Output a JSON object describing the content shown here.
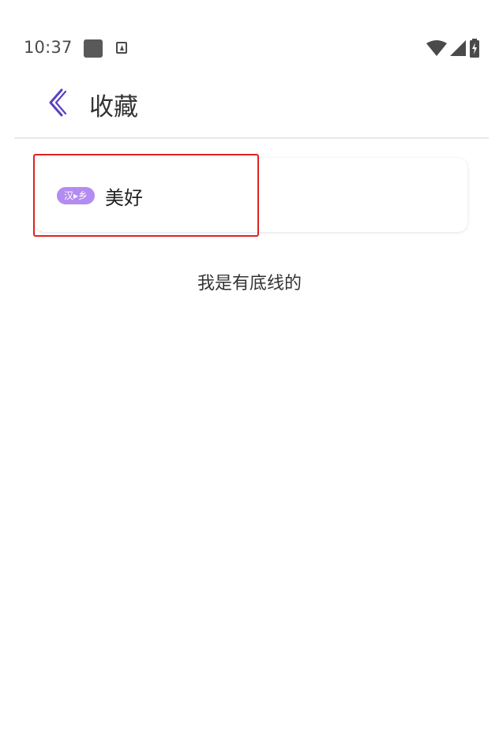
{
  "status_bar": {
    "time": "10:37",
    "icons": [
      "notification-square-icon",
      "notification-a-icon",
      "wifi-icon",
      "signal-icon",
      "battery-charging-icon"
    ]
  },
  "header": {
    "title": "收藏",
    "back_icon": "chevron-left-icon",
    "accent_color": "#5b3fc4"
  },
  "favorites": [
    {
      "badge": "汉▸乡",
      "word": "美好"
    }
  ],
  "footer": {
    "end_text": "我是有底线的"
  },
  "colors": {
    "badge": "#b38cf2",
    "highlight": "#e02222"
  }
}
